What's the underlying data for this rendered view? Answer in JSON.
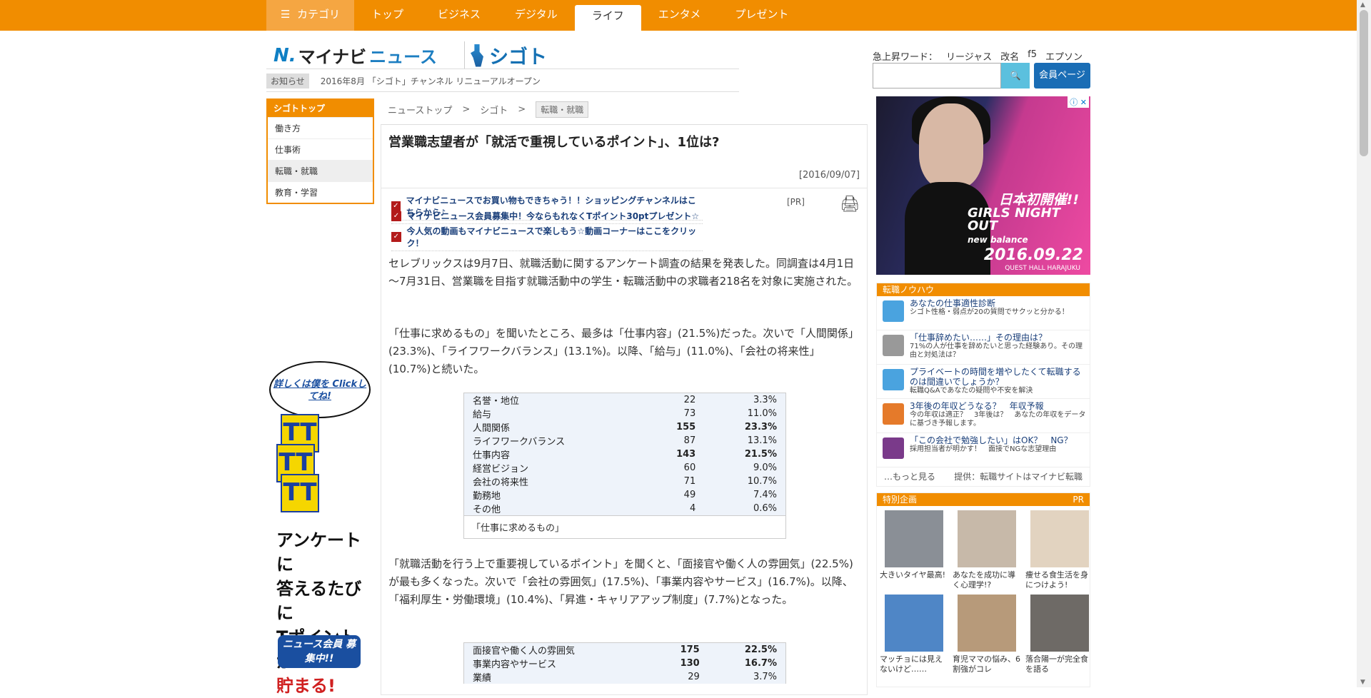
{
  "nav": {
    "category_label": "カテゴリ",
    "tabs": [
      "トップ",
      "ビジネス",
      "デジタル",
      "ライフ",
      "エンタメ",
      "プレゼント"
    ],
    "active_tab": "ライフ"
  },
  "brand": {
    "logo_main": "マイナビ",
    "logo_sub": "ニュース",
    "channel_logo": "シゴト"
  },
  "notice": {
    "tag": "お知らせ",
    "text": "2016年8月 「シゴト」チャンネル リニューアルオープン"
  },
  "trending": {
    "label": "急上昇ワード：",
    "words": [
      "リージャス",
      "改名",
      "f5",
      "エプソン"
    ]
  },
  "search": {
    "placeholder": "",
    "button_icon": "search-icon"
  },
  "member_button": "会員ページ",
  "sidebar": {
    "head": "シゴトトップ",
    "items": [
      "働き方",
      "仕事術",
      "転職・就職",
      "教育・学習"
    ],
    "active_item": "転職・就職"
  },
  "breadcrumb": [
    "ニューストップ",
    "シゴト",
    "転職・就職"
  ],
  "article": {
    "title": "営業職志望者が「就活で重視しているポイント」、1位は?",
    "date": "[2016/09/07]",
    "pr_links": [
      "マイナビニュースでお買い物もできちゃう！！ショッピングチャンネルはこちらから♪",
      "マイナビニュース会員募集中！今ならもれなくTポイント30ptプレゼント☆",
      "今人気の動画もマイナビニュースで楽しもう☆動画コーナーはここをクリック！"
    ],
    "pr_tag": "[PR]",
    "para1": "セレブリックスは9月7日、就職活動に関するアンケート調査の結果を発表した。同調査は4月1日～7月31日、営業職を目指す就職活動中の学生・転職活動中の求職者218名を対象に実施された。",
    "para2": "「仕事に求めるもの」を聞いたところ、最多は「仕事内容」(21.5%)だった。次いで「人間関係」(23.3%)、「ライフワークバランス」(13.1%)。以降、「給与」(11.0%)、「会社の将来性」(10.7%)と続いた。",
    "table1": {
      "rows": [
        [
          "名誉・地位",
          "22",
          "3.3%",
          false
        ],
        [
          "給与",
          "73",
          "11.0%",
          false
        ],
        [
          "人間関係",
          "155",
          "23.3%",
          true
        ],
        [
          "ライフワークバランス",
          "87",
          "13.1%",
          false
        ],
        [
          "仕事内容",
          "143",
          "21.5%",
          true
        ],
        [
          "経営ビジョン",
          "60",
          "9.0%",
          false
        ],
        [
          "会社の将来性",
          "71",
          "10.7%",
          false
        ],
        [
          "勤務地",
          "49",
          "7.4%",
          false
        ],
        [
          "その他",
          "4",
          "0.6%",
          false
        ]
      ],
      "caption": "「仕事に求めるもの」"
    },
    "para3": "「就職活動を行う上で重要視しているポイント」を聞くと、「面接官や働く人の雰囲気」(22.5%)が最も多くなった。次いで「会社の雰囲気」(17.5%)、「事業内容やサービス」(16.7%)。以降、「福利厚生・労働環境」(10.4%)、「昇進・キャリアアップ制度」(7.7%)となった。",
    "table2": {
      "rows": [
        [
          "面接官や働く人の雰囲気",
          "175",
          "22.5%",
          true
        ],
        [
          "事業内容やサービス",
          "130",
          "16.7%",
          true
        ],
        [
          "業績",
          "29",
          "3.7%",
          false
        ]
      ]
    }
  },
  "promo": {
    "bubble": "詳しくは僕を Clickしてね!",
    "text_line1": "アンケートに",
    "text_line2": "答えるたびに",
    "text_line3": "Tポイントが",
    "text_line4": "貯まる!",
    "badge": "ニュース会員 募集中!!"
  },
  "ad": {
    "headline": "日本初開催!!",
    "brand": "GIRLS NIGHT OUT",
    "sub": "new balance",
    "date": "2016.09.22",
    "venue": "QUEST HALL HARAJUKU"
  },
  "knowhow": {
    "head": "転職ノウハウ",
    "items": [
      {
        "title": "あなたの仕事適性診断",
        "sub": "シゴト性格・弱点が20の質問でサクッと分かる！"
      },
      {
        "title": "「仕事辞めたい……」その理由は？",
        "sub": "71%の人が仕事を辞めたいと思った経験あり。その理由と対処法は？"
      },
      {
        "title": "プライベートの時間を増やしたくて転職するのは間違いでしょうか？",
        "sub": "転職Q&Aであなたの疑問や不安を解決"
      },
      {
        "title": "3年後の年収どうなる？　年収予報",
        "sub": "今の年収は適正？　3年後は？　あなたの年収をデータに基づき予報します。"
      },
      {
        "title": "「この会社で勉強したい」はOK？　NG？",
        "sub": "採用担当者が明かす！　面接でNGな志望理由"
      }
    ],
    "more": "…もっと見る",
    "provider": "提供：転職サイトはマイナビ転職"
  },
  "special": {
    "head": "特別企画",
    "pr": "PR",
    "items": [
      "大きいタイヤ最高!",
      "あなたを成功に導く心理学!?",
      "痩せる食生活を身につけよう!",
      "マッチョには見えないけど……",
      "育児ママの悩み、6割強がコレ",
      "落合陽一が完全食を語る"
    ]
  }
}
